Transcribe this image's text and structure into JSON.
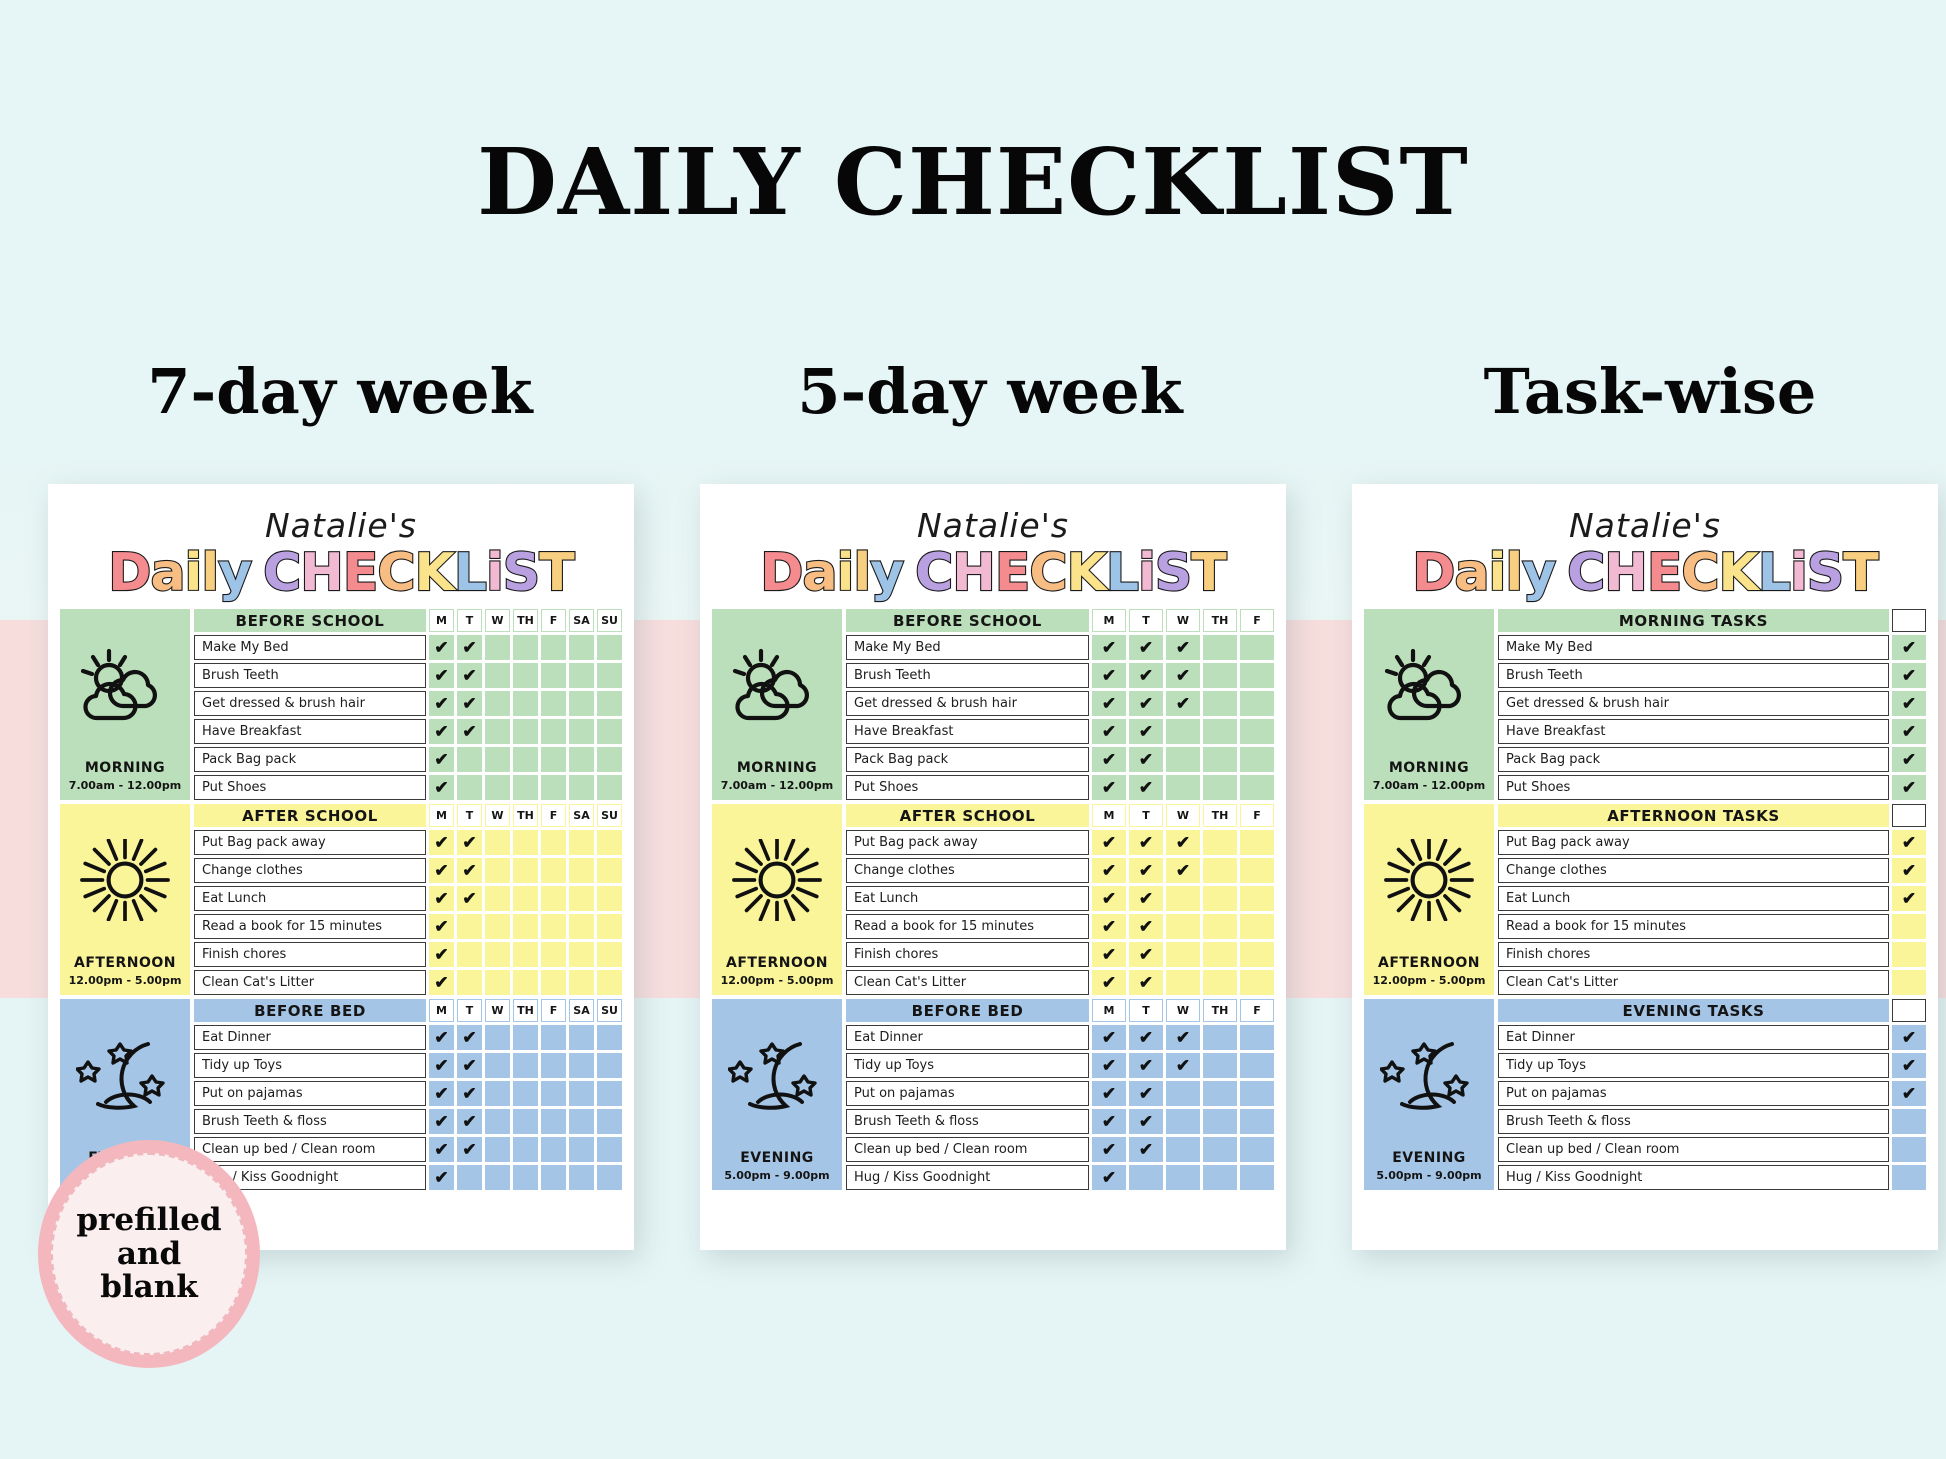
{
  "page": {
    "title": "DAILY CHECKLIST",
    "background_color": "#e3f3f3",
    "stripe_color": "#f7dedd"
  },
  "column_titles": [
    {
      "label": "7-day week"
    },
    {
      "label": "5-day week"
    },
    {
      "label": "Task-wise"
    }
  ],
  "badge": {
    "line1": "prefilled",
    "line2": "and",
    "line3": "blank",
    "ring_color": "#f4b7bd",
    "fill_color": "#fbeeef"
  },
  "sheet": {
    "owner_name": "Natalie's",
    "wordmark": "Daily Checklist",
    "wordmark_letters": [
      {
        "ch": "D",
        "color": "#f48b8f"
      },
      {
        "ch": "a",
        "color": "#f8bd83"
      },
      {
        "ch": "i",
        "color": "#fae38a"
      },
      {
        "ch": "l",
        "color": "#f8cf80"
      },
      {
        "ch": "y",
        "color": "#9dc3e6"
      },
      {
        "ch": " ",
        "color": ""
      },
      {
        "ch": "C",
        "color": "#b9a0e0"
      },
      {
        "ch": "H",
        "color": "#f2b9d3"
      },
      {
        "ch": "E",
        "color": "#f48b8f"
      },
      {
        "ch": "C",
        "color": "#f8bd83"
      },
      {
        "ch": "K",
        "color": "#fae38a"
      },
      {
        "ch": "L",
        "color": "#9dc3e6"
      },
      {
        "ch": "i",
        "color": "#f2b9d3"
      },
      {
        "ch": "S",
        "color": "#b9a0e0"
      },
      {
        "ch": "T",
        "color": "#f8cf80"
      }
    ]
  },
  "sections": {
    "morning": {
      "side_name": "MORNING",
      "side_time": "7.00am - 12.00pm",
      "icon": "sun-cloud-icon",
      "color": "#bcdfbb",
      "tasks": [
        "Make My Bed",
        "Brush Teeth",
        "Get dressed & brush hair",
        "Have Breakfast",
        "Pack Bag pack",
        "Put Shoes"
      ]
    },
    "afternoon": {
      "side_name": "AFTERNOON",
      "side_time": "12.00pm - 5.00pm",
      "icon": "sun-icon",
      "color": "#fbf59a",
      "tasks": [
        "Put Bag pack away",
        "Change clothes",
        "Eat Lunch",
        "Read a book for 15 minutes",
        "Finish chores",
        "Clean Cat's Litter"
      ]
    },
    "evening": {
      "side_name": "EVENING",
      "side_time": "5.00pm - 9.00pm",
      "icon": "moon-stars-icon",
      "color": "#a5c5e6",
      "tasks": [
        "Eat Dinner",
        "Tidy up Toys",
        "Put on pajamas",
        "Brush Teeth & floss",
        "Clean up bed / Clean room",
        "Hug / Kiss Goodnight"
      ]
    }
  },
  "check_glyph": "✔",
  "cards": [
    {
      "id": "seven-day-week",
      "title": "7-day week",
      "day_headers": [
        "M",
        "T",
        "W",
        "TH",
        "F",
        "SA",
        "SU"
      ],
      "section_headers": {
        "morning": "BEFORE SCHOOL",
        "afternoon": "AFTER SCHOOL",
        "evening": "BEFORE BED"
      },
      "checks": {
        "morning": [
          [
            true,
            true,
            false,
            false,
            false,
            false,
            false
          ],
          [
            true,
            true,
            false,
            false,
            false,
            false,
            false
          ],
          [
            true,
            true,
            false,
            false,
            false,
            false,
            false
          ],
          [
            true,
            true,
            false,
            false,
            false,
            false,
            false
          ],
          [
            true,
            false,
            false,
            false,
            false,
            false,
            false
          ],
          [
            true,
            false,
            false,
            false,
            false,
            false,
            false
          ]
        ],
        "afternoon": [
          [
            true,
            true,
            false,
            false,
            false,
            false,
            false
          ],
          [
            true,
            true,
            false,
            false,
            false,
            false,
            false
          ],
          [
            true,
            true,
            false,
            false,
            false,
            false,
            false
          ],
          [
            true,
            false,
            false,
            false,
            false,
            false,
            false
          ],
          [
            true,
            false,
            false,
            false,
            false,
            false,
            false
          ],
          [
            true,
            false,
            false,
            false,
            false,
            false,
            false
          ]
        ],
        "evening": [
          [
            true,
            true,
            false,
            false,
            false,
            false,
            false
          ],
          [
            true,
            true,
            false,
            false,
            false,
            false,
            false
          ],
          [
            true,
            true,
            false,
            false,
            false,
            false,
            false
          ],
          [
            true,
            true,
            false,
            false,
            false,
            false,
            false
          ],
          [
            true,
            true,
            false,
            false,
            false,
            false,
            false
          ],
          [
            true,
            false,
            false,
            false,
            false,
            false,
            false
          ]
        ]
      }
    },
    {
      "id": "five-day-week",
      "title": "5-day week",
      "day_headers": [
        "M",
        "T",
        "W",
        "TH",
        "F"
      ],
      "section_headers": {
        "morning": "BEFORE SCHOOL",
        "afternoon": "AFTER SCHOOL",
        "evening": "BEFORE BED"
      },
      "checks": {
        "morning": [
          [
            true,
            true,
            true,
            false,
            false
          ],
          [
            true,
            true,
            true,
            false,
            false
          ],
          [
            true,
            true,
            true,
            false,
            false
          ],
          [
            true,
            true,
            false,
            false,
            false
          ],
          [
            true,
            true,
            false,
            false,
            false
          ],
          [
            true,
            true,
            false,
            false,
            false
          ]
        ],
        "afternoon": [
          [
            true,
            true,
            true,
            false,
            false
          ],
          [
            true,
            true,
            true,
            false,
            false
          ],
          [
            true,
            true,
            false,
            false,
            false
          ],
          [
            true,
            true,
            false,
            false,
            false
          ],
          [
            true,
            true,
            false,
            false,
            false
          ],
          [
            true,
            true,
            false,
            false,
            false
          ]
        ],
        "evening": [
          [
            true,
            true,
            true,
            false,
            false
          ],
          [
            true,
            true,
            true,
            false,
            false
          ],
          [
            true,
            true,
            false,
            false,
            false
          ],
          [
            true,
            true,
            false,
            false,
            false
          ],
          [
            true,
            true,
            false,
            false,
            false
          ],
          [
            true,
            false,
            false,
            false,
            false
          ]
        ]
      }
    },
    {
      "id": "task-wise",
      "title": "Task-wise",
      "day_headers": [],
      "section_headers": {
        "morning": "MORNING TASKS",
        "afternoon": "AFTERNOON TASKS",
        "evening": "EVENING TASKS"
      },
      "checks": {
        "morning": [
          [
            true
          ],
          [
            true
          ],
          [
            true
          ],
          [
            true
          ],
          [
            true
          ],
          [
            true
          ]
        ],
        "afternoon": [
          [
            true
          ],
          [
            true
          ],
          [
            true
          ],
          [
            false
          ],
          [
            false
          ],
          [
            false
          ]
        ],
        "evening": [
          [
            true
          ],
          [
            true
          ],
          [
            true
          ],
          [
            false
          ],
          [
            false
          ],
          [
            false
          ]
        ]
      }
    }
  ]
}
